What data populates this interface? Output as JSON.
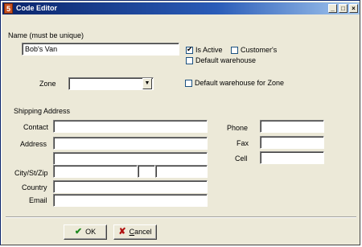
{
  "window": {
    "title": "Code Editor",
    "app_icon_glyph": "5"
  },
  "titlebar_buttons": {
    "minimize": "_",
    "maximize": "□",
    "close": "×"
  },
  "name": {
    "label": "Name (must be unique)",
    "value": "Bob's Van"
  },
  "checkboxes": {
    "is_active": {
      "label": "Is Active",
      "checked": true
    },
    "customers": {
      "label": "Customer's",
      "checked": false
    },
    "default_warehouse": {
      "label": "Default warehouse",
      "checked": false
    },
    "default_warehouse_zone": {
      "label": "Default warehouse for Zone",
      "checked": false
    }
  },
  "zone": {
    "label": "Zone",
    "value": ""
  },
  "shipping": {
    "section_label": "Shipping Address",
    "contact_label": "Contact",
    "address_label": "Address",
    "city_label": "City/St/Zip",
    "country_label": "Country",
    "email_label": "Email",
    "contact": "",
    "address1": "",
    "address2": "",
    "city": "",
    "state": "",
    "zip": "",
    "country": "",
    "email": ""
  },
  "phones": {
    "phone_label": "Phone",
    "fax_label": "Fax",
    "cell_label": "Cell",
    "phone": "",
    "fax": "",
    "cell": ""
  },
  "buttons": {
    "ok_label": "OK",
    "cancel_label": "ancel",
    "cancel_underline": "C"
  },
  "colors": {
    "ok_icon": "#1f8a1f",
    "cancel_icon": "#b01010"
  }
}
